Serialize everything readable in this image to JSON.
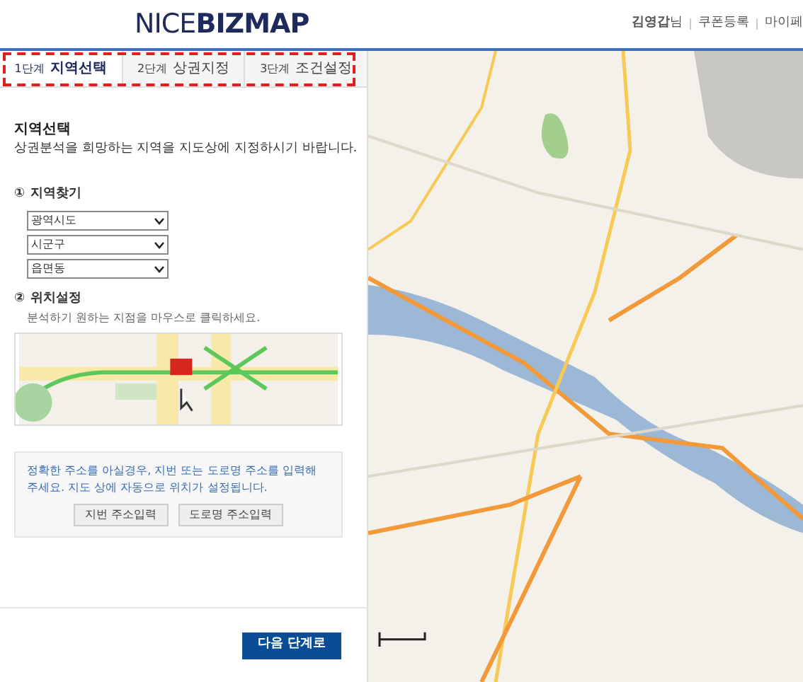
{
  "header": {
    "logo": "NICE**BIZMAP**",
    "user_links": [
      {
        "label": "**김영갑**님"
      },
      {
        "label": "쿠폰등록"
      },
      {
        "label": "마이페"
      }
    ]
  },
  "tabs": [
    {
      "step": "1단계",
      "label": "지역선택",
      "selected": true
    },
    {
      "step": "2단계",
      "label": "상권지정",
      "selected": false
    },
    {
      "step": "3단계",
      "label": "조건설정",
      "selected": false
    }
  ],
  "intro": {
    "title": "지역선택",
    "description": "상권분석을 희망하는 지역을 지도상에 지정하시기 바랍니다."
  },
  "find_region": {
    "number": "①",
    "title": "지역찾기",
    "selects": [
      {
        "value": "광역시도"
      },
      {
        "value": "시군구"
      },
      {
        "value": "읍면동"
      }
    ]
  },
  "set_location": {
    "number": "②",
    "title": "위치설정",
    "hint": "분석하기 원하는 지점을 마우스로 클릭하세요."
  },
  "address_box": {
    "text": "정확한 주소를 아실경우, 지번 또는 도로명 주소를 입력해 주세요. 지도 상에 자동으로 위치가 설정됩니다.",
    "buttons": [
      "지번 주소입력",
      "도로명 주소입력"
    ]
  },
  "next_button": "다음 단계로"
}
